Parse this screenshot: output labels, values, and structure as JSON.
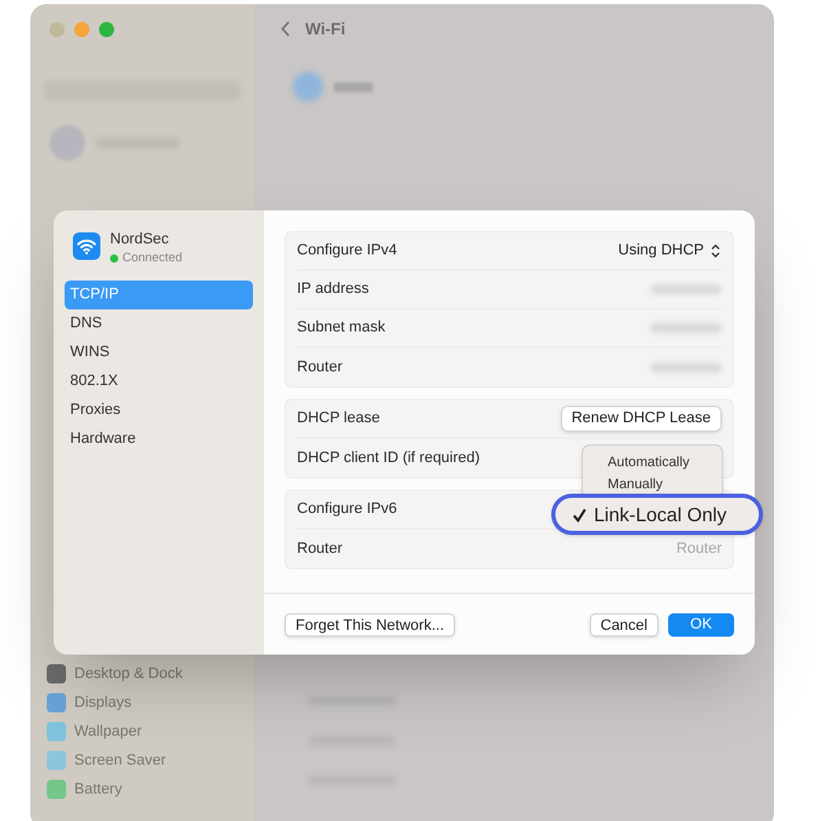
{
  "window": {
    "title": "Wi-Fi"
  },
  "background_sidebar": {
    "items": [
      {
        "label": "Desktop & Dock",
        "color": "#6b6b6b"
      },
      {
        "label": "Displays",
        "color": "#6aa3d8"
      },
      {
        "label": "Wallpaper",
        "color": "#7fc4dc"
      },
      {
        "label": "Screen Saver",
        "color": "#8cc6dc"
      },
      {
        "label": "Battery",
        "color": "#76c68a"
      }
    ]
  },
  "dialog": {
    "network": {
      "name": "NordSec",
      "status": "Connected",
      "connected": true
    },
    "sidebar": [
      {
        "label": "TCP/IP",
        "selected": true
      },
      {
        "label": "DNS",
        "selected": false
      },
      {
        "label": "WINS",
        "selected": false
      },
      {
        "label": "802.1X",
        "selected": false
      },
      {
        "label": "Proxies",
        "selected": false
      },
      {
        "label": "Hardware",
        "selected": false
      }
    ],
    "groups": [
      {
        "rows": [
          {
            "kind": "popup",
            "label": "Configure IPv4",
            "value": "Using DHCP"
          },
          {
            "kind": "redacted",
            "label": "IP address"
          },
          {
            "kind": "redacted",
            "label": "Subnet mask"
          },
          {
            "kind": "redacted",
            "label": "Router"
          }
        ]
      },
      {
        "rows": [
          {
            "kind": "button",
            "label": "DHCP lease",
            "value": "Renew DHCP Lease"
          },
          {
            "kind": "plain",
            "label": "DHCP client ID (if required)"
          }
        ]
      },
      {
        "rows": [
          {
            "kind": "plain",
            "label": "Configure IPv6"
          },
          {
            "kind": "text",
            "label": "Router",
            "value": "Router"
          }
        ]
      }
    ],
    "menu": [
      {
        "label": "Automatically",
        "selected": false
      },
      {
        "label": "Manually",
        "selected": false
      },
      {
        "label": "Link-Local Only",
        "selected": true
      }
    ],
    "buttons": [
      {
        "label": "Forget This Network...",
        "kind": "default"
      },
      {
        "label": "Cancel",
        "kind": "default"
      },
      {
        "label": "OK",
        "kind": "primary"
      }
    ]
  }
}
